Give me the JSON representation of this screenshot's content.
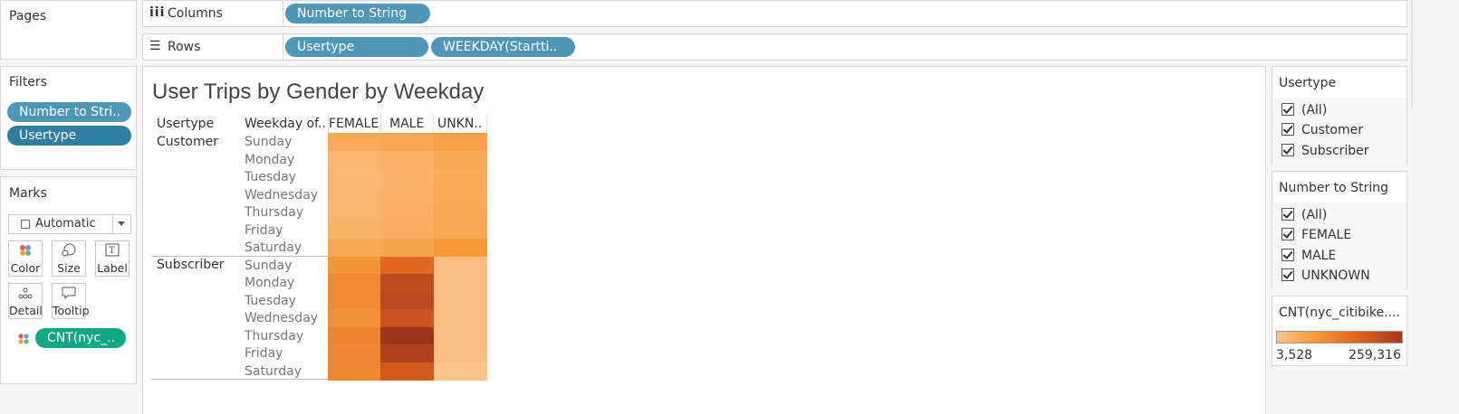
{
  "shelves": {
    "pages_title": "Pages",
    "columns_label": "Columns",
    "columns_pill": "Number to String",
    "rows_label": "Rows",
    "rows_pills": [
      "Usertype",
      "WEEKDAY(Startti.."
    ]
  },
  "filters": {
    "title": "Filters",
    "pills": [
      "Number to Stri..",
      "Usertype"
    ]
  },
  "marks": {
    "title": "Marks",
    "mark_type": "Automatic",
    "buttons": [
      "Color",
      "Size",
      "Label",
      "Detail",
      "Tooltip"
    ],
    "color_pill": "CNT(nyc_.."
  },
  "viz": {
    "title": "User Trips by Gender by Weekday",
    "headers": [
      "Usertype",
      "Weekday of..",
      "FEMALE",
      "MALE",
      "UNKN.."
    ],
    "groups": [
      "Customer",
      "Subscriber"
    ],
    "weekdays": [
      "Sunday",
      "Monday",
      "Tuesday",
      "Wednesday",
      "Thursday",
      "Friday",
      "Saturday"
    ]
  },
  "usertype_filter": {
    "title": "Usertype",
    "items": [
      "(All)",
      "Customer",
      "Subscriber"
    ]
  },
  "gender_filter": {
    "title": "Number to String",
    "items": [
      "(All)",
      "FEMALE",
      "MALE",
      "UNKNOWN"
    ]
  },
  "legend": {
    "title": "CNT(nyc_citibike....",
    "min": "3,528",
    "max": "259,316",
    "color_min": "#fbc58a",
    "color_max": "#a13a1c"
  },
  "chart_data": {
    "type": "heatmap",
    "title": "User Trips by Gender by Weekday",
    "columns": [
      "FEMALE",
      "MALE",
      "UNKNOWN"
    ],
    "rows": [
      {
        "usertype": "Customer",
        "weekday": "Sunday",
        "values": [
          13000,
          15000,
          24000
        ]
      },
      {
        "usertype": "Customer",
        "weekday": "Monday",
        "values": [
          7000,
          9000,
          15000
        ]
      },
      {
        "usertype": "Customer",
        "weekday": "Tuesday",
        "values": [
          6000,
          8000,
          14000
        ]
      },
      {
        "usertype": "Customer",
        "weekday": "Wednesday",
        "values": [
          6000,
          9000,
          14000
        ]
      },
      {
        "usertype": "Customer",
        "weekday": "Thursday",
        "values": [
          7000,
          10000,
          15000
        ]
      },
      {
        "usertype": "Customer",
        "weekday": "Friday",
        "values": [
          8000,
          11000,
          17000
        ]
      },
      {
        "usertype": "Customer",
        "weekday": "Saturday",
        "values": [
          17000,
          19000,
          33000
        ]
      },
      {
        "usertype": "Subscriber",
        "weekday": "Sunday",
        "values": [
          36000,
          118000,
          4000
        ]
      },
      {
        "usertype": "Subscriber",
        "weekday": "Monday",
        "values": [
          50000,
          188000,
          4000
        ]
      },
      {
        "usertype": "Subscriber",
        "weekday": "Tuesday",
        "values": [
          52000,
          195000,
          4000
        ]
      },
      {
        "usertype": "Subscriber",
        "weekday": "Wednesday",
        "values": [
          42000,
          165000,
          4000
        ]
      },
      {
        "usertype": "Subscriber",
        "weekday": "Thursday",
        "values": [
          62000,
          259316,
          4000
        ]
      },
      {
        "usertype": "Subscriber",
        "weekday": "Friday",
        "values": [
          55000,
          220000,
          4000
        ]
      },
      {
        "usertype": "Subscriber",
        "weekday": "Saturday",
        "values": [
          54000,
          150000,
          3528
        ]
      }
    ],
    "color_range": [
      3528,
      259316
    ]
  }
}
